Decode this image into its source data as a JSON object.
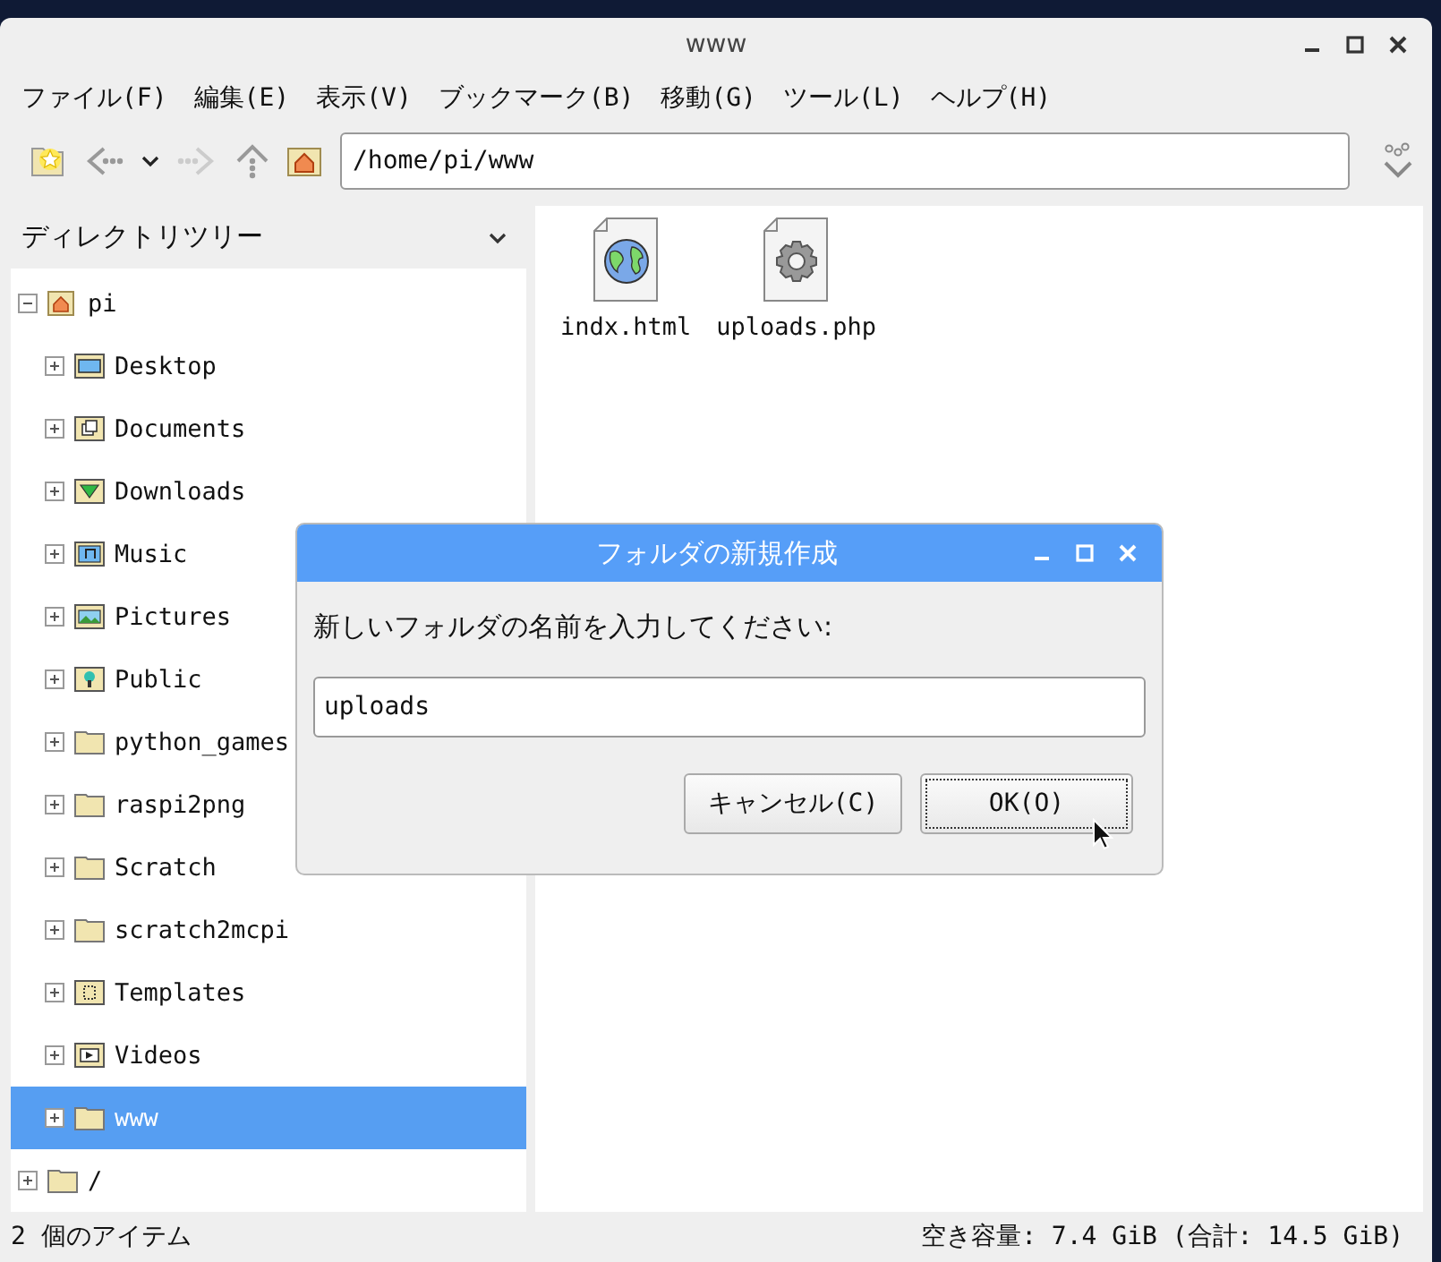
{
  "window": {
    "title": "www"
  },
  "menu": [
    "ファイル(F)",
    "編集(E)",
    "表示(V)",
    "ブックマーク(B)",
    "移動(G)",
    "ツール(L)",
    "ヘルプ(H)"
  ],
  "toolbar": {
    "path": "/home/pi/www"
  },
  "sidebar": {
    "header": "ディレクトリツリー",
    "tree": [
      {
        "label": "pi",
        "kind": "home",
        "expanded": true,
        "selected": false,
        "children": [
          {
            "label": "Desktop",
            "kind": "desktop",
            "expanded": false,
            "selected": false
          },
          {
            "label": "Documents",
            "kind": "documents",
            "expanded": false,
            "selected": false
          },
          {
            "label": "Downloads",
            "kind": "downloads",
            "expanded": false,
            "selected": false
          },
          {
            "label": "Music",
            "kind": "music",
            "expanded": false,
            "selected": false
          },
          {
            "label": "Pictures",
            "kind": "pictures",
            "expanded": false,
            "selected": false
          },
          {
            "label": "Public",
            "kind": "public",
            "expanded": false,
            "selected": false
          },
          {
            "label": "python_games",
            "kind": "folder",
            "expanded": false,
            "selected": false
          },
          {
            "label": "raspi2png",
            "kind": "folder",
            "expanded": false,
            "selected": false
          },
          {
            "label": "Scratch",
            "kind": "folder",
            "expanded": false,
            "selected": false
          },
          {
            "label": "scratch2mcpi",
            "kind": "folder",
            "expanded": false,
            "selected": false
          },
          {
            "label": "Templates",
            "kind": "templates",
            "expanded": false,
            "selected": false
          },
          {
            "label": "Videos",
            "kind": "videos",
            "expanded": false,
            "selected": false
          },
          {
            "label": "www",
            "kind": "folder",
            "expanded": false,
            "selected": true
          }
        ]
      },
      {
        "label": "/",
        "kind": "folder",
        "expanded": false,
        "selected": false
      }
    ]
  },
  "files": [
    {
      "name": "indx.html",
      "kind": "html"
    },
    {
      "name": "uploads.php",
      "kind": "php"
    }
  ],
  "status_bar": {
    "left": "2 個のアイテム",
    "right": "空き容量: 7.4 GiB (合計: 14.5 GiB)"
  },
  "dialog": {
    "title": "フォルダの新規作成",
    "prompt": "新しいフォルダの名前を入力してください:",
    "value": "uploads",
    "buttons": [
      {
        "label": "キャンセル(C)",
        "focused": false
      },
      {
        "label": "OK(O)",
        "focused": true
      }
    ]
  }
}
